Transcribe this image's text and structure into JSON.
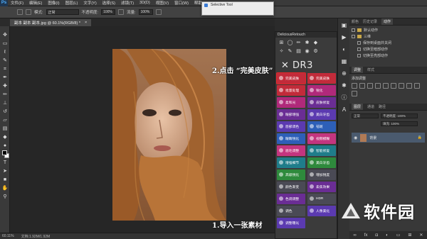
{
  "app": {
    "logo": "Ps",
    "menu": [
      "文件(F)",
      "编辑(E)",
      "图像(I)",
      "图层(L)",
      "文字(Y)",
      "选择(S)",
      "滤镜(T)",
      "3D(D)",
      "视图(V)",
      "窗口(W)",
      "帮助(H)"
    ]
  },
  "options": {
    "mode_label": "模式:",
    "mode_value": "正常",
    "opacity_label": "不透明度:",
    "opacity_value": "100%",
    "flow_label": "流量:",
    "flow_value": "100%"
  },
  "document": {
    "tab_title": "副本 副本 副本.jpg @ 60.1%(RGB/8) *",
    "close_glyph": "×"
  },
  "status": {
    "zoom": "60.11%",
    "doc_size": "文档:1.92M/1.92M"
  },
  "annotations": {
    "step1": "1.导入一张素材",
    "step2": "2.点击 “完美皮肤”"
  },
  "dr_panel": {
    "title": "DeliciousRetouch",
    "logo": "DR3",
    "buttons": [
      {
        "label": "完美皮肤",
        "color": "red",
        "highlighted": true
      },
      {
        "label": "完美皮肤",
        "color": "red",
        "highlighted": false
      },
      {
        "label": "批量处理",
        "color": "red",
        "highlighted": false
      },
      {
        "label": "锐化",
        "color": "magenta",
        "highlighted": false
      },
      {
        "label": "柔和光",
        "color": "magenta",
        "highlighted": false
      },
      {
        "label": "皮肤修复",
        "color": "purple",
        "highlighted": false
      },
      {
        "label": "眼部增强",
        "color": "purple",
        "highlighted": false
      },
      {
        "label": "美白牙齿",
        "color": "violet",
        "highlighted": false
      },
      {
        "label": "唇部调色",
        "color": "violet",
        "highlighted": false
      },
      {
        "label": "祛斑",
        "color": "blue",
        "highlighted": false
      },
      {
        "label": "眼睛锐化",
        "color": "blue",
        "highlighted": false
      },
      {
        "label": "视频模糊",
        "color": "pink",
        "highlighted": false
      },
      {
        "label": "眉毛调整",
        "color": "pink",
        "highlighted": false
      },
      {
        "label": "智能修复",
        "color": "teal",
        "highlighted": false
      },
      {
        "label": "增强细节",
        "color": "teal",
        "highlighted": false
      },
      {
        "label": "美白牙齿",
        "color": "green",
        "highlighted": false
      },
      {
        "label": "高级锐化",
        "color": "green",
        "highlighted": false
      },
      {
        "label": "增加锐度",
        "color": "dark",
        "highlighted": false
      },
      {
        "label": "颜色渐变",
        "color": "dark",
        "highlighted": false
      },
      {
        "label": "柔焦效果",
        "color": "purple",
        "highlighted": false
      },
      {
        "label": "色调调整",
        "color": "purple",
        "highlighted": false
      },
      {
        "label": "HDR",
        "color": "dark",
        "highlighted": false
      },
      {
        "label": "调色",
        "color": "dark",
        "highlighted": false
      },
      {
        "label": "人像美化",
        "color": "violet",
        "highlighted": false
      },
      {
        "label": "调整曝光",
        "color": "violet",
        "highlighted": false
      }
    ]
  },
  "selective_tool": {
    "title": "Selective Tool"
  },
  "right_panels": {
    "top_tabs": [
      "颜色",
      "历史记录",
      "动作"
    ],
    "actions": [
      "默认动作",
      "三维",
      "保存到桌面并关闭",
      "切换至暗部动作",
      "切换至亮部动作"
    ],
    "adjust_tabs": [
      "调整",
      "样式"
    ],
    "adjust_title": "添加调整",
    "layers_tabs": [
      "图层",
      "通道",
      "路径"
    ],
    "blend_mode": "正常",
    "opacity_label": "不透明度: 100%",
    "fill_label": "填充: 100%",
    "layer_name": "背景"
  },
  "watermark": {
    "text": "软件园"
  }
}
